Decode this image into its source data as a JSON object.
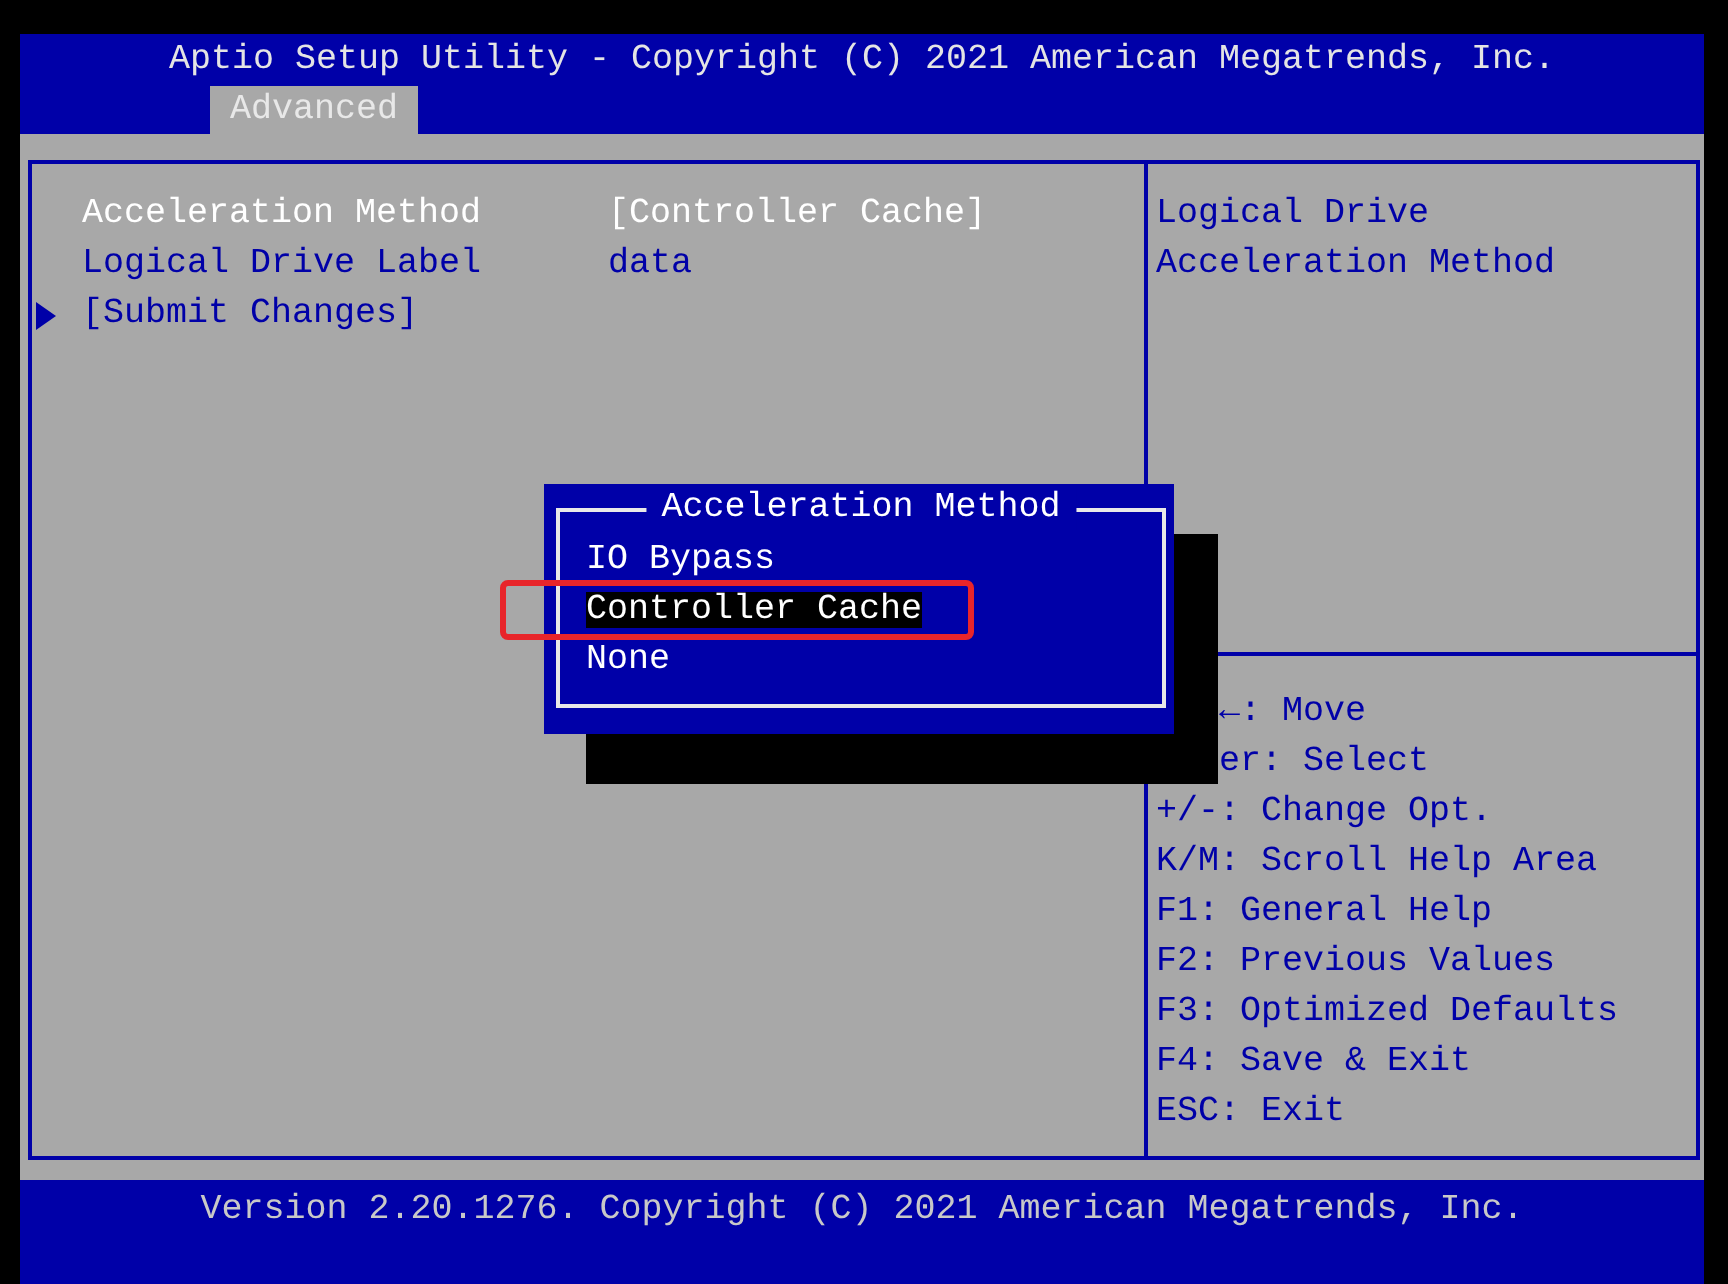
{
  "window": {
    "title": "Aptio Setup Utility - Copyright (C) 2021 American Megatrends, Inc."
  },
  "tabs": [
    {
      "label": "Advanced",
      "selected": true
    }
  ],
  "settings": [
    {
      "kind": "option",
      "label": "Acceleration Method",
      "value": "[Controller Cache]",
      "selected": true
    },
    {
      "kind": "option",
      "label": "Logical Drive Label",
      "value": "data",
      "selected": false
    },
    {
      "kind": "submenu",
      "label": "[Submit Changes]",
      "selected": false
    }
  ],
  "help": {
    "description": "Logical Drive Acceleration Method",
    "keys": [
      {
        "kind": "partly_covered",
        "text": "←: Move"
      },
      {
        "kind": "partly_covered",
        "text": "er: Select"
      },
      {
        "kind": "full",
        "text": "+/-: Change Opt."
      },
      {
        "kind": "full",
        "text": "K/M: Scroll Help Area"
      },
      {
        "kind": "full",
        "text": "F1: General Help"
      },
      {
        "kind": "full",
        "text": "F2: Previous Values"
      },
      {
        "kind": "full",
        "text": "F3: Optimized Defaults"
      },
      {
        "kind": "full",
        "text": "F4: Save & Exit"
      },
      {
        "kind": "full",
        "text": "ESC: Exit"
      }
    ]
  },
  "popup": {
    "title": "Acceleration Method",
    "options": [
      {
        "label": "IO Bypass",
        "selected": false,
        "marked": false
      },
      {
        "label": "Controller Cache",
        "selected": true,
        "marked": true
      },
      {
        "label": "None",
        "selected": false,
        "marked": false
      }
    ]
  },
  "status_bar": {
    "text": "Version 2.20.1276. Copyright (C) 2021 American Megatrends, Inc."
  }
}
